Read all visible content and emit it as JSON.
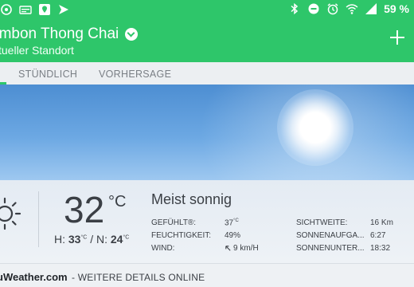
{
  "statusbar": {
    "battery": "59 %",
    "icons": [
      "notification-icon",
      "card-icon",
      "map-icon",
      "send-icon",
      "bluetooth-icon",
      "dnd-icon",
      "alarm-icon",
      "wifi-icon",
      "signal-icon"
    ]
  },
  "appbar": {
    "title": "ambon Thong Chai",
    "subtitle": "tueller Standort"
  },
  "tabs": {
    "hourly": "STÜNDLICH",
    "forecast": "VORHERSAGE"
  },
  "current": {
    "temperature": "32",
    "unit": "°C",
    "hi_label": "H:",
    "hi": "33",
    "lo_label": "/ N:",
    "lo": "24",
    "small_unit": "°C",
    "condition": "Meist sonnig"
  },
  "details": {
    "feels_label": "GEFÜHLT®:",
    "feels_value": "37",
    "feels_unit": "°C",
    "humidity_label": "FEUCHTIGKEIT:",
    "humidity_value": "49%",
    "wind_label": "WIND:",
    "wind_value": "9 km/H",
    "visibility_label": "SICHTWEITE:",
    "visibility_value": "16 Km",
    "sunrise_label": "SONNENAUFGA...",
    "sunrise_value": "6:27",
    "sunset_label": "SONNENUNTER...",
    "sunset_value": "18:32"
  },
  "footer": {
    "brand": "uWeather.com",
    "more": "- WEITERE DETAILS ONLINE"
  },
  "colors": {
    "accent": "#2ec66a",
    "text": "#3b3f45"
  }
}
